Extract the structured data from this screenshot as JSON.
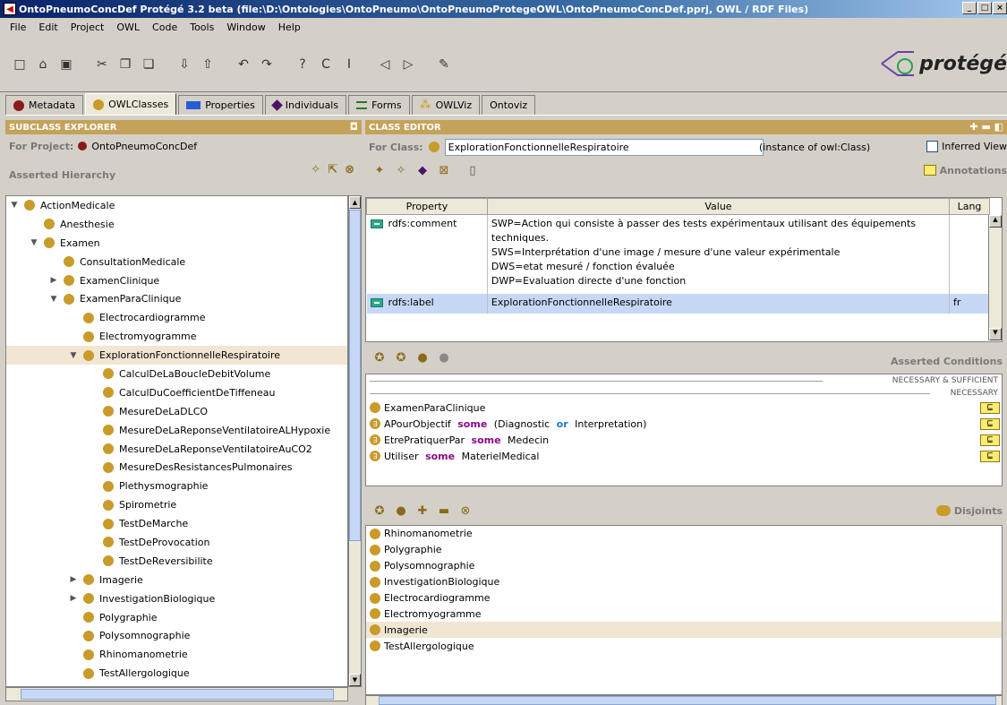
{
  "window": {
    "title": "OntoPneumoConcDef  Protégé 3.2 beta   (file:\\D:\\Ontologies\\OntoPneumo\\OntoPneumoProtegeOWL\\OntoPneumoConcDef.pprj, OWL / RDF Files)",
    "controls": [
      "_",
      "□",
      "×"
    ]
  },
  "menu": [
    "File",
    "Edit",
    "Project",
    "OWL",
    "Code",
    "Tools",
    "Window",
    "Help"
  ],
  "logo_text": "protégé",
  "tabs": [
    {
      "label": "Metadata",
      "icon": "red-dot"
    },
    {
      "label": "OWLClasses",
      "icon": "class-dot",
      "active": true
    },
    {
      "label": "Properties",
      "icon": "blue-rect"
    },
    {
      "label": "Individuals",
      "icon": "purple-diamond"
    },
    {
      "label": "Forms",
      "icon": "green-lines"
    },
    {
      "label": "OWLViz",
      "icon": "owlviz-icon"
    },
    {
      "label": "Ontoviz",
      "icon": ""
    }
  ],
  "left": {
    "header": "SUBCLASS EXPLORER",
    "for_project_label": "For Project:",
    "project_name": "OntoPneumoConcDef",
    "hierarchy_label": "Asserted Hierarchy",
    "tree": [
      {
        "label": "ActionMedicale",
        "level": 0,
        "toggle": "▼"
      },
      {
        "label": "Anesthesie",
        "level": 1,
        "toggle": ""
      },
      {
        "label": "Examen",
        "level": 1,
        "toggle": "▼"
      },
      {
        "label": "ConsultationMedicale",
        "level": 2,
        "toggle": ""
      },
      {
        "label": "ExamenClinique",
        "level": 2,
        "toggle": "▶"
      },
      {
        "label": "ExamenParaClinique",
        "level": 2,
        "toggle": "▼"
      },
      {
        "label": "Electrocardiogramme",
        "level": 3,
        "toggle": ""
      },
      {
        "label": "Electromyogramme",
        "level": 3,
        "toggle": ""
      },
      {
        "label": "ExplorationFonctionnelleRespiratoire",
        "level": 3,
        "toggle": "▼",
        "selected": true
      },
      {
        "label": "CalculDeLaBoucleDebitVolume",
        "level": 4,
        "toggle": ""
      },
      {
        "label": "CalculDuCoefficientDeTiffeneau",
        "level": 4,
        "toggle": ""
      },
      {
        "label": "MesureDeLaDLCO",
        "level": 4,
        "toggle": ""
      },
      {
        "label": "MesureDeLaReponseVentilatoireALHypoxie",
        "level": 4,
        "toggle": ""
      },
      {
        "label": "MesureDeLaReponseVentilatoireAuCO2",
        "level": 4,
        "toggle": ""
      },
      {
        "label": "MesureDesResistancesPulmonaires",
        "level": 4,
        "toggle": ""
      },
      {
        "label": "Plethysmographie",
        "level": 4,
        "toggle": ""
      },
      {
        "label": "Spirometrie",
        "level": 4,
        "toggle": ""
      },
      {
        "label": "TestDeMarche",
        "level": 4,
        "toggle": ""
      },
      {
        "label": "TestDeProvocation",
        "level": 4,
        "toggle": ""
      },
      {
        "label": "TestDeReversibilite",
        "level": 4,
        "toggle": ""
      },
      {
        "label": "Imagerie",
        "level": 3,
        "toggle": "▶"
      },
      {
        "label": "InvestigationBiologique",
        "level": 3,
        "toggle": "▶"
      },
      {
        "label": "Polygraphie",
        "level": 3,
        "toggle": ""
      },
      {
        "label": "Polysomnographie",
        "level": 3,
        "toggle": ""
      },
      {
        "label": "Rhinomanometrie",
        "level": 3,
        "toggle": ""
      },
      {
        "label": "TestAllergologique",
        "level": 3,
        "toggle": ""
      }
    ]
  },
  "right": {
    "header": "CLASS EDITOR",
    "for_class_label": "For Class:",
    "class_name": "ExplorationFonctionnelleRespiratoire",
    "instance_of": "(instance of owl:Class)",
    "inferred_view": "Inferred View",
    "annotations_label": "Annotations",
    "annotation_columns": [
      "Property",
      "Value",
      "Lang"
    ],
    "annotations": [
      {
        "property": "rdfs:comment",
        "value_lines": [
          "SWP=Action qui consiste à passer des tests expérimentaux utilisant des équipements",
          "techniques.",
          "SWS=Interprétation d'une image / mesure d'une valeur expérimentale",
          "DWS=etat mesuré / fonction évaluée",
          "DWP=Evaluation directe d'une fonction"
        ],
        "lang": ""
      },
      {
        "property": "rdfs:label",
        "value_lines": [
          "ExplorationFonctionnelleRespiratoire"
        ],
        "lang": "fr"
      }
    ],
    "conditions_label": "Asserted Conditions",
    "nec_suff_label": "NECESSARY & SUFFICIENT",
    "necessary_label": "NECESSARY",
    "conditions": [
      {
        "parts": [
          {
            "t": "ExamenParaClinique",
            "k": ""
          }
        ],
        "icon": "class"
      },
      {
        "parts": [
          {
            "t": "APourObjectif ",
            "k": ""
          },
          {
            "t": "some",
            "k": "kw"
          },
          {
            "t": " (Diagnostic ",
            "k": ""
          },
          {
            "t": "or",
            "k": "kwb"
          },
          {
            "t": " Interpretation)",
            "k": ""
          }
        ],
        "icon": "restriction"
      },
      {
        "parts": [
          {
            "t": "EtrePratiquerPar ",
            "k": ""
          },
          {
            "t": "some",
            "k": "kw"
          },
          {
            "t": " Medecin",
            "k": ""
          }
        ],
        "icon": "restriction"
      },
      {
        "parts": [
          {
            "t": "Utiliser ",
            "k": ""
          },
          {
            "t": "some",
            "k": "kw"
          },
          {
            "t": " MaterielMedical",
            "k": ""
          }
        ],
        "icon": "restriction"
      }
    ],
    "subclass_symbol": "⊑",
    "disjoints_label": "Disjoints",
    "disjoints": [
      "Rhinomanometrie",
      "Polygraphie",
      "Polysomnographie",
      "InvestigationBiologique",
      "Electrocardiogramme",
      "Electromyogramme",
      "Imagerie",
      "TestAllergologique"
    ],
    "disjoint_selected": "Imagerie"
  }
}
